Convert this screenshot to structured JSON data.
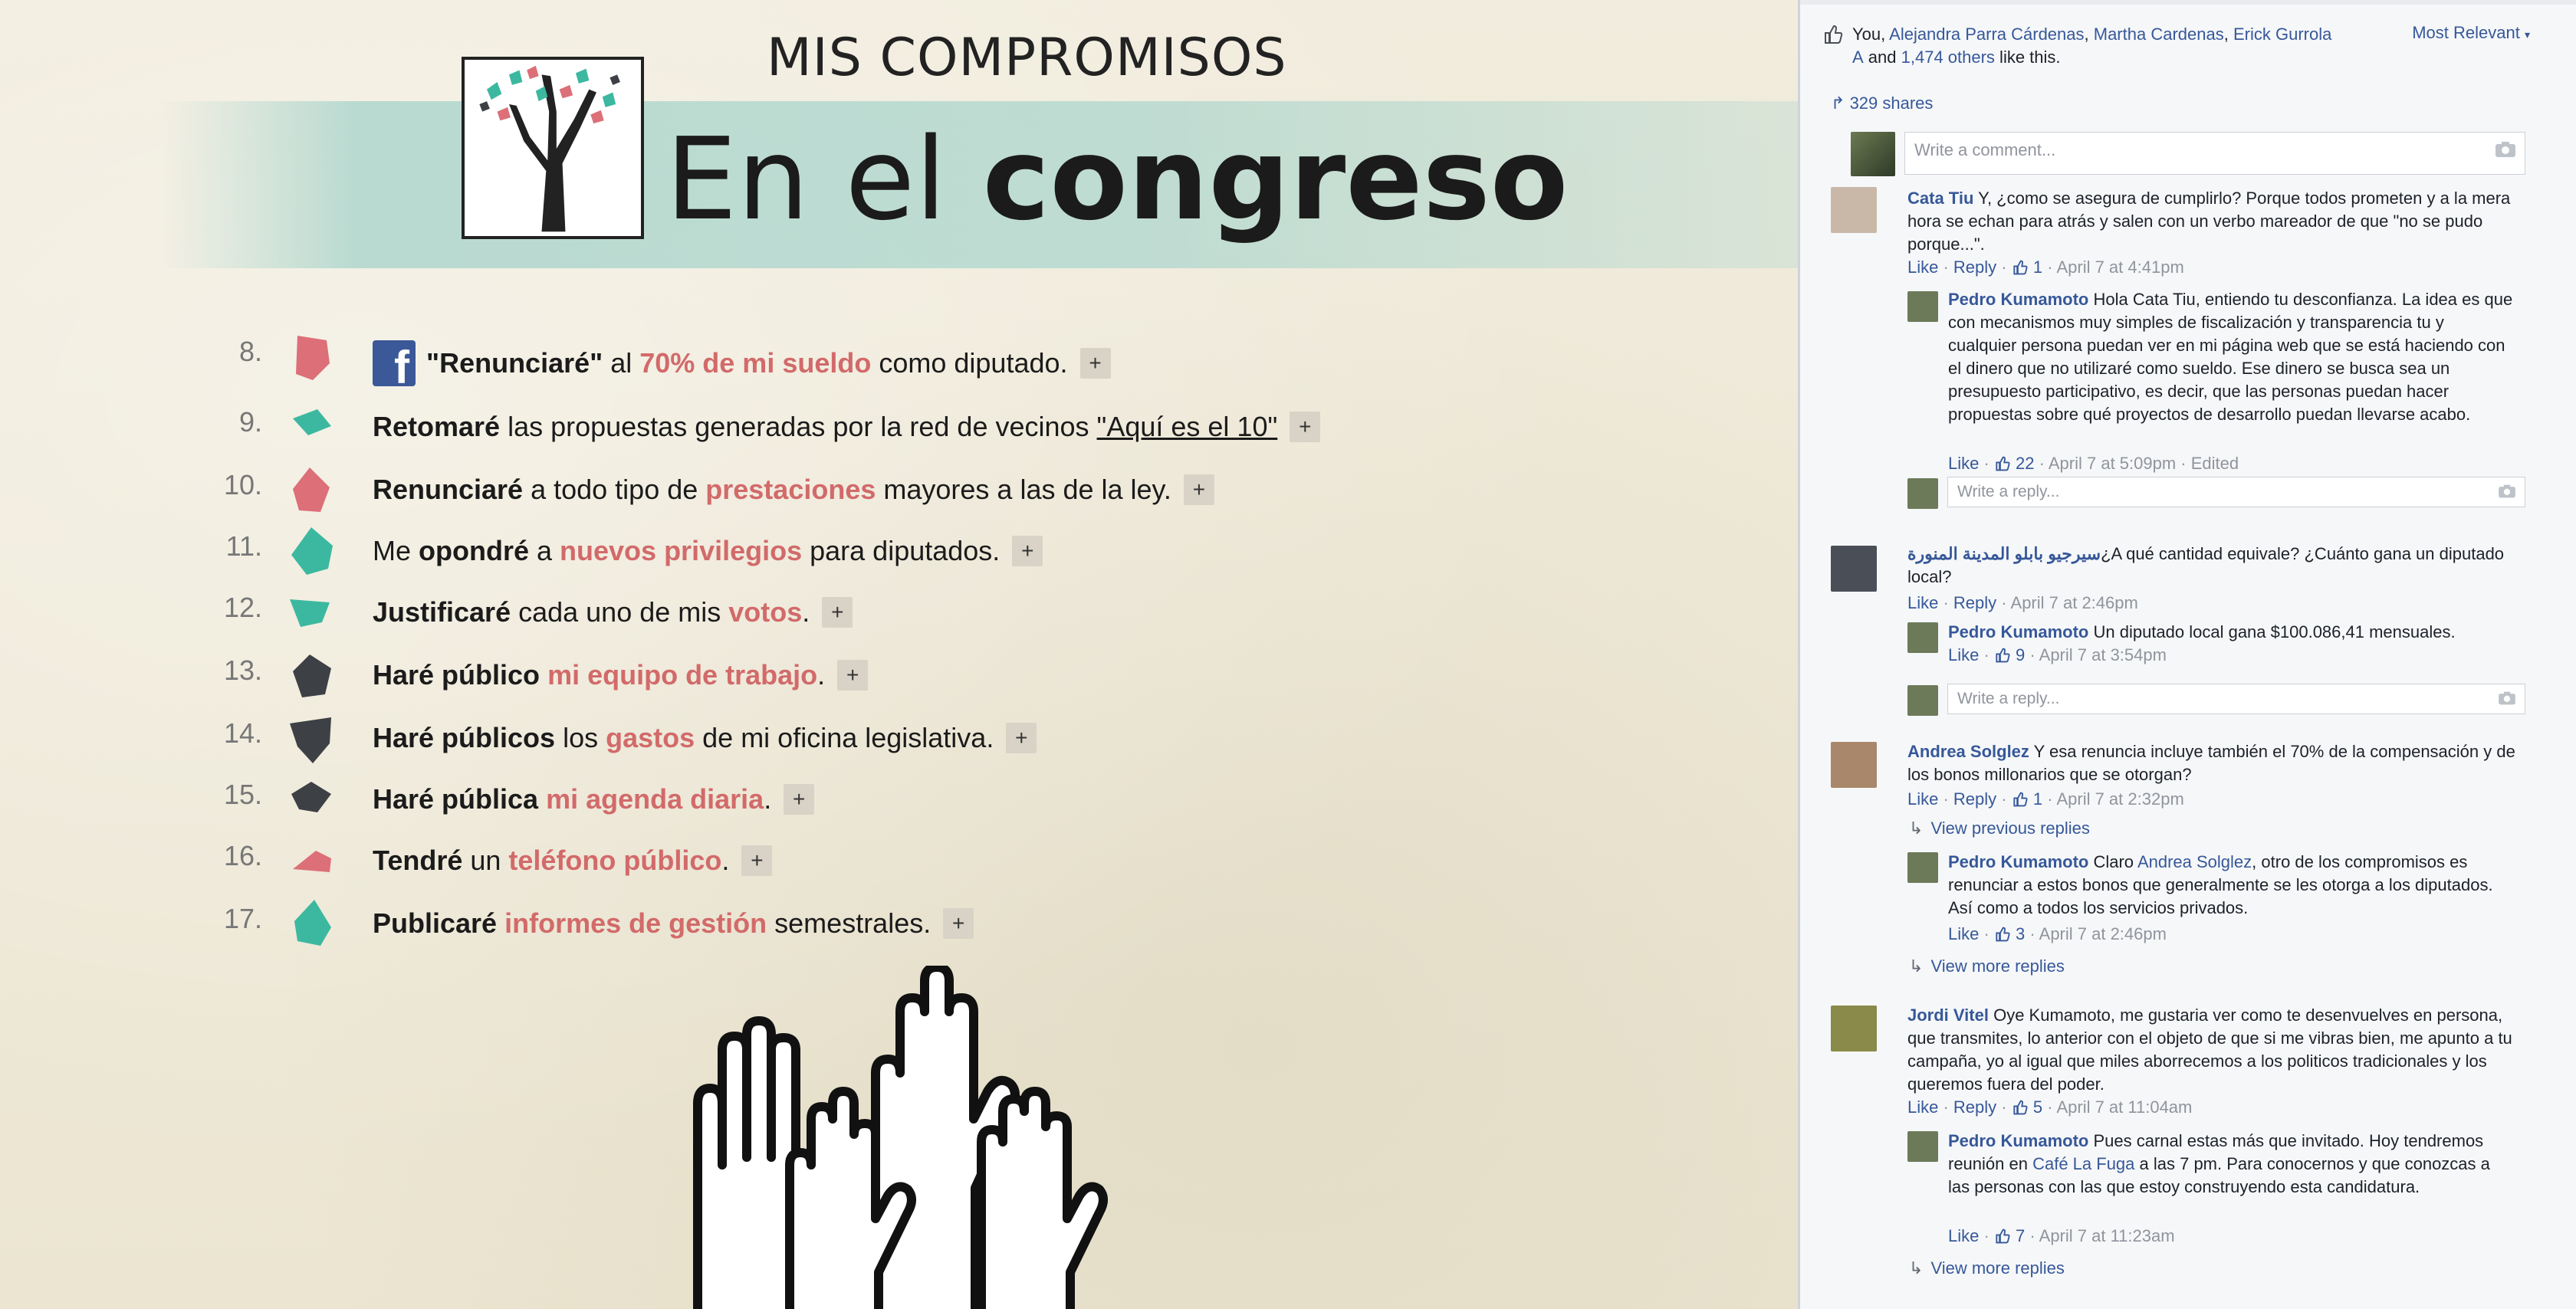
{
  "left": {
    "kicker": "MIS COMPROMISOS",
    "headline_light": "En el ",
    "headline_bold": "congreso",
    "items": [
      {
        "num": "8.",
        "color": "#dc6f77",
        "parts": [
          {
            "t": "\"Renunciaré\"",
            "s": "b"
          },
          {
            "t": " al ",
            "s": "n"
          },
          {
            "t": "70% de mi sueldo",
            "s": "r"
          },
          {
            "t": " como diputado.",
            "s": "n"
          }
        ],
        "fb": true
      },
      {
        "num": "9.",
        "color": "#3cb8a0",
        "parts": [
          {
            "t": "Retomaré",
            "s": "b"
          },
          {
            "t": " las propuestas generadas por la red de vecinos ",
            "s": "n"
          },
          {
            "t": "\"Aquí es el 10\"",
            "s": "u"
          }
        ]
      },
      {
        "num": "10.",
        "color": "#dc6f77",
        "parts": [
          {
            "t": "Renunciaré",
            "s": "b"
          },
          {
            "t": " a todo tipo de ",
            "s": "n"
          },
          {
            "t": "prestaciones",
            "s": "r"
          },
          {
            "t": " mayores a las de la ley.",
            "s": "n"
          }
        ]
      },
      {
        "num": "11.",
        "color": "#3cb8a0",
        "parts": [
          {
            "t": "Me ",
            "s": "n"
          },
          {
            "t": "opondré",
            "s": "b"
          },
          {
            "t": " a ",
            "s": "n"
          },
          {
            "t": "nuevos privilegios",
            "s": "r"
          },
          {
            "t": " para diputados.",
            "s": "n"
          }
        ]
      },
      {
        "num": "12.",
        "color": "#3cb8a0",
        "parts": [
          {
            "t": "Justificaré",
            "s": "b"
          },
          {
            "t": " cada uno de mis ",
            "s": "n"
          },
          {
            "t": "votos",
            "s": "r"
          },
          {
            "t": ".",
            "s": "n"
          }
        ]
      },
      {
        "num": "13.",
        "color": "#3d4045",
        "parts": [
          {
            "t": "Haré público",
            "s": "b"
          },
          {
            "t": " ",
            "s": "n"
          },
          {
            "t": "mi equipo de trabajo",
            "s": "r"
          },
          {
            "t": ".",
            "s": "n"
          }
        ]
      },
      {
        "num": "14.",
        "color": "#3d4045",
        "parts": [
          {
            "t": "Haré públicos",
            "s": "b"
          },
          {
            "t": " los ",
            "s": "n"
          },
          {
            "t": "gastos",
            "s": "r"
          },
          {
            "t": " de mi oficina legislativa.",
            "s": "n"
          }
        ]
      },
      {
        "num": "15.",
        "color": "#3d4045",
        "parts": [
          {
            "t": "Haré pública",
            "s": "b"
          },
          {
            "t": " ",
            "s": "n"
          },
          {
            "t": "mi agenda diaria",
            "s": "r"
          },
          {
            "t": ".",
            "s": "n"
          }
        ]
      },
      {
        "num": "16.",
        "color": "#dc6f77",
        "parts": [
          {
            "t": "Tendré",
            "s": "b"
          },
          {
            "t": " un ",
            "s": "n"
          },
          {
            "t": "teléfono público",
            "s": "r"
          },
          {
            "t": ".",
            "s": "n"
          }
        ]
      },
      {
        "num": "17.",
        "color": "#3cb8a0",
        "parts": [
          {
            "t": "Publicaré",
            "s": "b"
          },
          {
            "t": " ",
            "s": "n"
          },
          {
            "t": "informes de gestión",
            "s": "r"
          },
          {
            "t": " semestrales.",
            "s": "n"
          }
        ]
      }
    ],
    "plus_label": "+"
  },
  "right": {
    "likes_you": "You, ",
    "likes_names": [
      "Alejandra Parra Cárdenas",
      "Martha Cardenas",
      "Erick Gurrola A"
    ],
    "likes_and": " and ",
    "likes_others": "1,474 others",
    "likes_tail": " like this.",
    "sort_label": "Most Relevant",
    "shares": "329 shares",
    "comment_placeholder": "Write a comment...",
    "reply_placeholder": "Write a reply...",
    "like_label": "Like",
    "reply_label": "Reply",
    "comments": [
      {
        "name": "Cata Tiu",
        "text": " Y, ¿como se asegura de cumplirlo? Porque todos prometen y a la mera hora se echan para atrás y salen con un verbo mareador de que \"no se pudo porque...\".",
        "likes": "1",
        "time": "April 7 at 4:41pm"
      },
      {
        "name": "Pedro Kumamoto",
        "text": " Hola Cata Tiu, entiendo tu desconfianza. La idea es que con mecanismos muy simples de fiscalización y transparencia tu y cualquier persona puedan ver en mi página web que se está haciendo con el dinero que no utilizaré como sueldo. Ese dinero se busca sea un presupuesto participativo, es decir, que las personas puedan hacer propuestas sobre qué proyectos de desarrollo puedan llevarse acabo.",
        "likes": "22",
        "time": "April 7 at 5:09pm · Edited"
      },
      {
        "name": "سيرجيو بابلو المدينة المنورة",
        "text": "¿A qué cantidad equivale? ¿Cuánto gana un diputado local?",
        "time": "April 7 at 2:46pm"
      },
      {
        "name": "Pedro Kumamoto",
        "text": " Un diputado local gana $100.086,41 mensuales.",
        "likes": "9",
        "time": "April 7 at 3:54pm"
      },
      {
        "name": "Andrea Solglez",
        "text": " Y esa renuncia incluye también el 70% de la compensación y de los bonos millonarios que se otorgan?",
        "likes": "1",
        "time": "April 7 at 2:32pm"
      },
      {
        "name": "Pedro Kumamoto",
        "text_a": " Claro ",
        "mention": "Andrea Solglez",
        "text_b": ", otro de los compromisos es renunciar a estos bonos que generalmente se les otorga a los diputados. Así como a todos los servicios privados.",
        "likes": "3",
        "time": "April 7 at 2:46pm"
      },
      {
        "name": "Jordi Vitel",
        "text": " Oye Kumamoto, me gustaria ver como te desenvuelves en persona, que transmites, lo anterior con el objeto de que si me vibras bien, me apunto a tu campaña, yo al igual que miles aborrecemos a los politicos tradicionales y los queremos fuera del poder.",
        "likes": "5",
        "time": "April 7 at 11:04am"
      },
      {
        "name": "Pedro Kumamoto",
        "text_a": " Pues carnal estas más que invitado. Hoy tendremos reunión en ",
        "mention": "Café La Fuga",
        "text_b": " a las 7 pm. Para conocernos y que conozcas a las personas con las que estoy construyendo esta candidatura.",
        "likes": "7",
        "time": "April 7 at 11:23am"
      }
    ],
    "view_previous": "View previous replies",
    "view_more": "View more replies"
  }
}
